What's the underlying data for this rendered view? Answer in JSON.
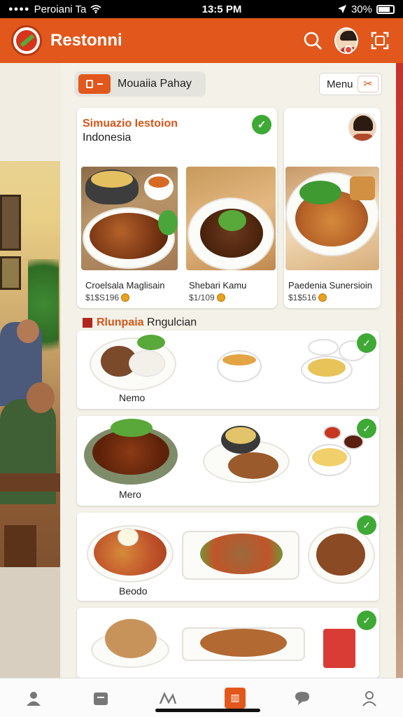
{
  "status_bar": {
    "carrier": "Peroiani Ta",
    "time": "13:5 PM",
    "battery": "30%"
  },
  "app_bar": {
    "title": "Restonni"
  },
  "toolbar": {
    "location_label": "Mouaiia Pahay",
    "menu_label": "Menu"
  },
  "restaurant": {
    "name": "Simuazio Iestoion",
    "country": "Indonesia"
  },
  "featured_dishes": [
    {
      "name": "Croelsala Maglisain",
      "price": "$1$S196"
    },
    {
      "name": "Shebari Kamu",
      "price": "$1/109"
    },
    {
      "name": "Paedenia Sunersioin",
      "price": "$1$516"
    }
  ],
  "section": {
    "accent": "Rlunpaia",
    "rest": " Rngulcian"
  },
  "menu_cards": [
    {
      "label": "Nemo"
    },
    {
      "label": "Mero"
    },
    {
      "label": "Beodo"
    },
    {
      "label": ""
    }
  ],
  "colors": {
    "brand": "#e2571b",
    "check": "#3fa935",
    "price_coin": "#e8a21f"
  },
  "icons": {
    "app_bar": [
      "search-icon",
      "avatar",
      "scan-icon"
    ],
    "bottom_nav": [
      "profile-icon",
      "orders-icon",
      "routes-icon",
      "menu-tab-icon",
      "chat-icon",
      "account-icon"
    ]
  }
}
